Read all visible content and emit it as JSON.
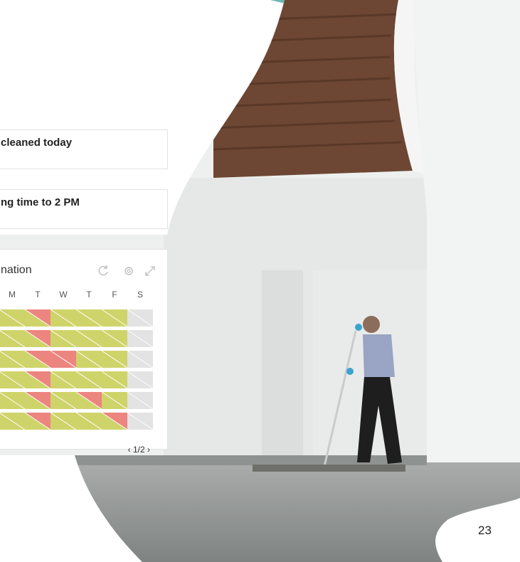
{
  "cards": {
    "card1_text": "cleaned today",
    "card2_text": "ng time to 2 PM"
  },
  "calendar": {
    "title": "nation",
    "days": [
      "M",
      "T",
      "W",
      "T",
      "F",
      "S"
    ],
    "rows": [
      [
        "y",
        "r",
        "y",
        "y",
        "y",
        "g"
      ],
      [
        "y",
        "r",
        "y",
        "y",
        "y",
        "g"
      ],
      [
        "y",
        "r",
        "R",
        "y",
        "y",
        "g"
      ],
      [
        "y",
        "r",
        "y",
        "y",
        "y",
        "g"
      ],
      [
        "y",
        "r",
        "y",
        "r",
        "y",
        "g"
      ],
      [
        "y",
        "r",
        "y",
        "y",
        "r",
        "g"
      ]
    ],
    "pager": {
      "prev": "‹",
      "label": "1/2",
      "next": "›"
    },
    "colors": {
      "yellow": "#cfd46a",
      "red": "#ec8580",
      "gray": "#e3e3e3"
    }
  },
  "page_number": "23",
  "accent_color": "#6bb7b4",
  "icons": [
    "refresh-icon",
    "settings-icon",
    "expand-icon"
  ]
}
